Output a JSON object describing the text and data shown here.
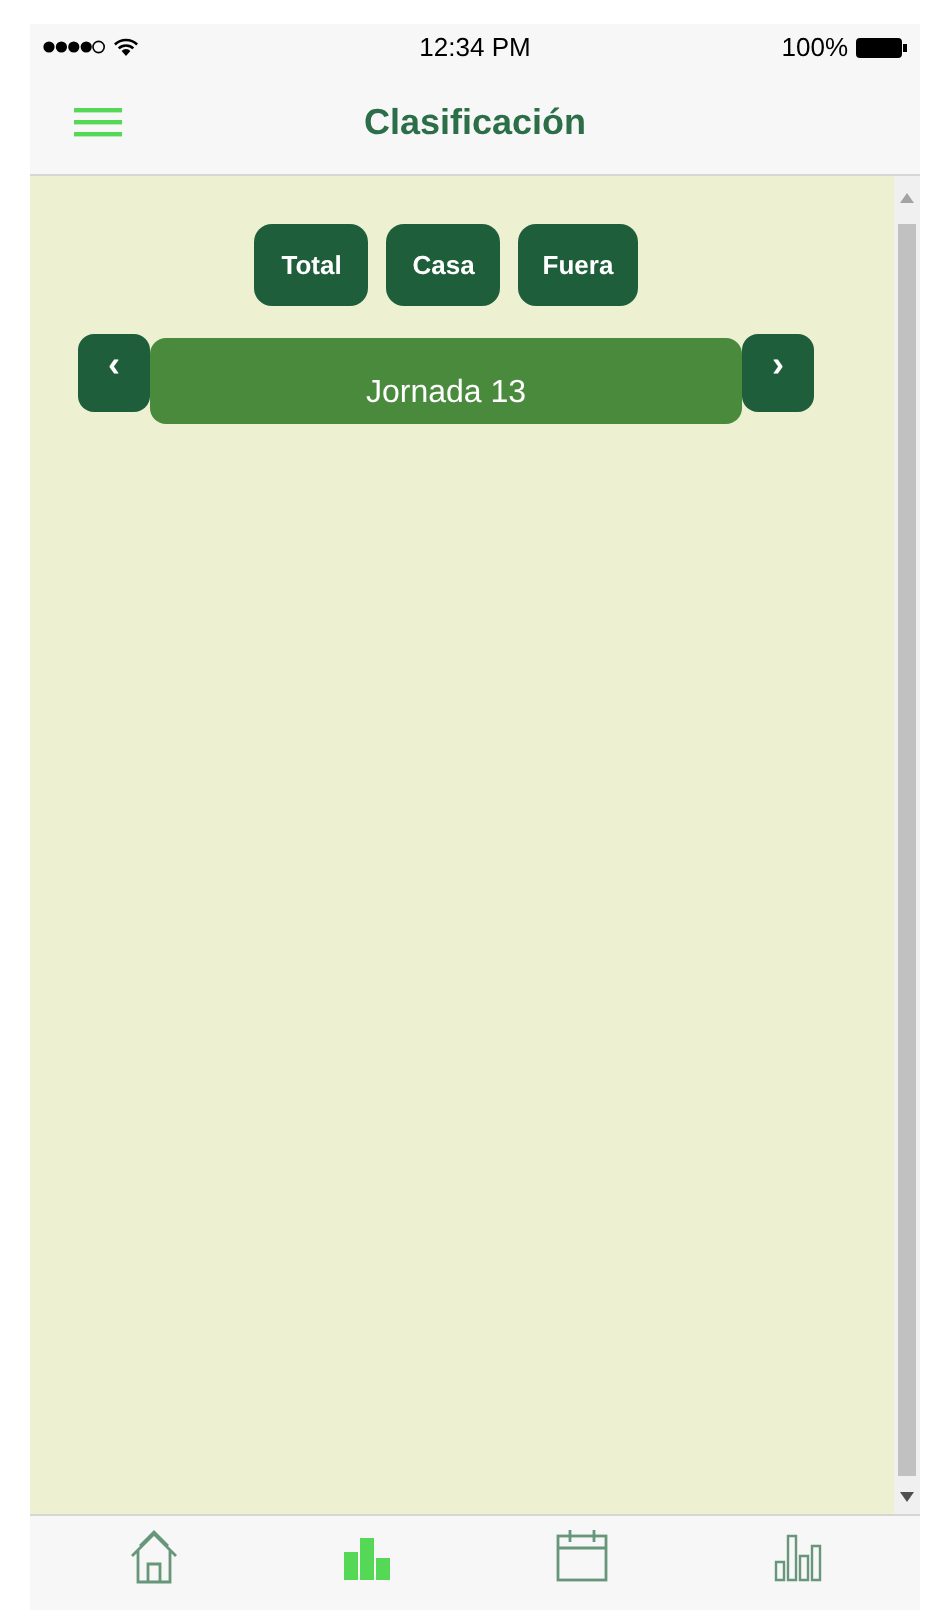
{
  "status_bar": {
    "time": "12:34 PM",
    "battery": "100%"
  },
  "header": {
    "title": "Clasificación"
  },
  "filters": [
    "Total",
    "Casa",
    "Fuera"
  ],
  "round_selector": {
    "previous": "‹",
    "label": "Jornada 13",
    "next": "›"
  },
  "tab_bar": [
    {
      "kind": "home",
      "selected": false
    },
    {
      "kind": "standings",
      "selected": true
    },
    {
      "kind": "calendar",
      "selected": false
    },
    {
      "kind": "stats",
      "selected": false
    }
  ]
}
